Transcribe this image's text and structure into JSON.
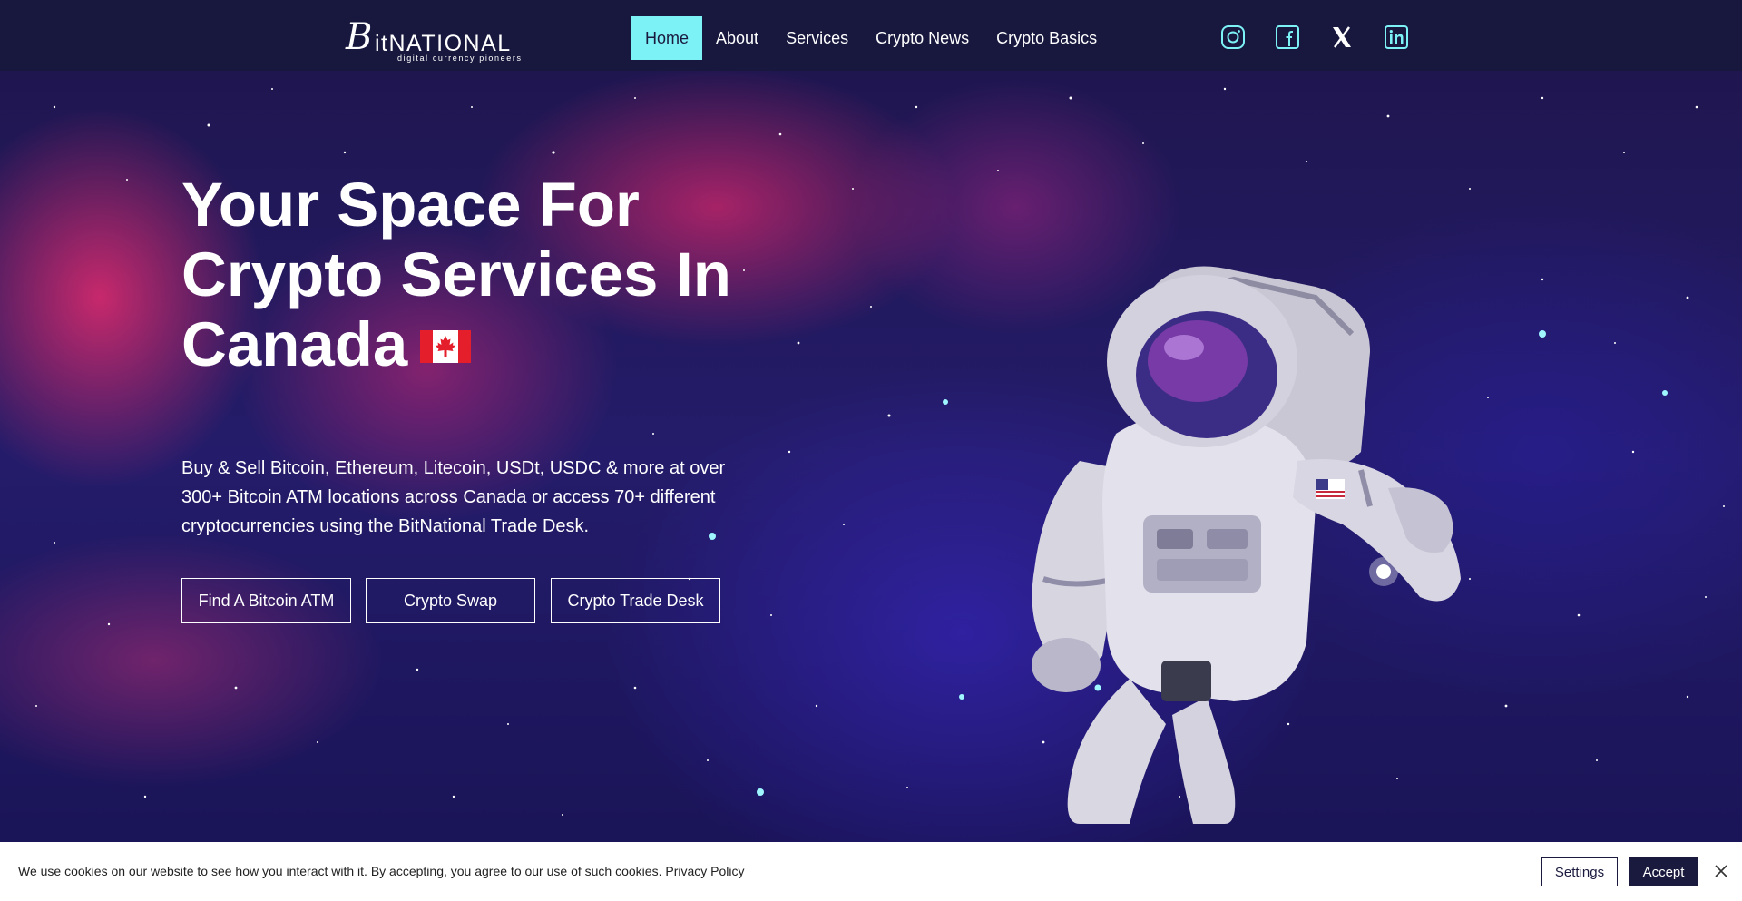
{
  "brand": {
    "logo_initial": "B",
    "logo_word": "itNATIONAL",
    "tagline": "digital currency pioneers"
  },
  "nav": {
    "items": [
      {
        "label": "Home",
        "active": true
      },
      {
        "label": "About",
        "active": false
      },
      {
        "label": "Services",
        "active": false
      },
      {
        "label": "Crypto News",
        "active": false
      },
      {
        "label": "Crypto Basics",
        "active": false
      }
    ],
    "active_color": "#7cf1f6"
  },
  "social": [
    "instagram-icon",
    "facebook-icon",
    "x-icon",
    "linkedin-icon"
  ],
  "hero": {
    "title_line1": "Your Space For",
    "title_line2": "Crypto Services In",
    "title_line3": "Canada",
    "description": "Buy & Sell Bitcoin, Ethereum, Litecoin, USDt, USDC & more at over 300+ Bitcoin ATM locations across Canada or access 70+ different cryptocurrencies using the BitNational Trade Desk.",
    "buttons": {
      "find_atm": "Find A Bitcoin ATM",
      "crypto_swap": "Crypto Swap",
      "trade_desk": "Crypto Trade Desk"
    }
  },
  "cookie": {
    "message": "We use cookies on our website to see how you interact with it. By accepting, you agree to our use of such cookies.",
    "policy_link": "Privacy Policy",
    "settings_label": "Settings",
    "accept_label": "Accept"
  },
  "colors": {
    "header_bg": "#18183f",
    "accent": "#7cf1f6",
    "dark_button": "#1a1a3e"
  }
}
